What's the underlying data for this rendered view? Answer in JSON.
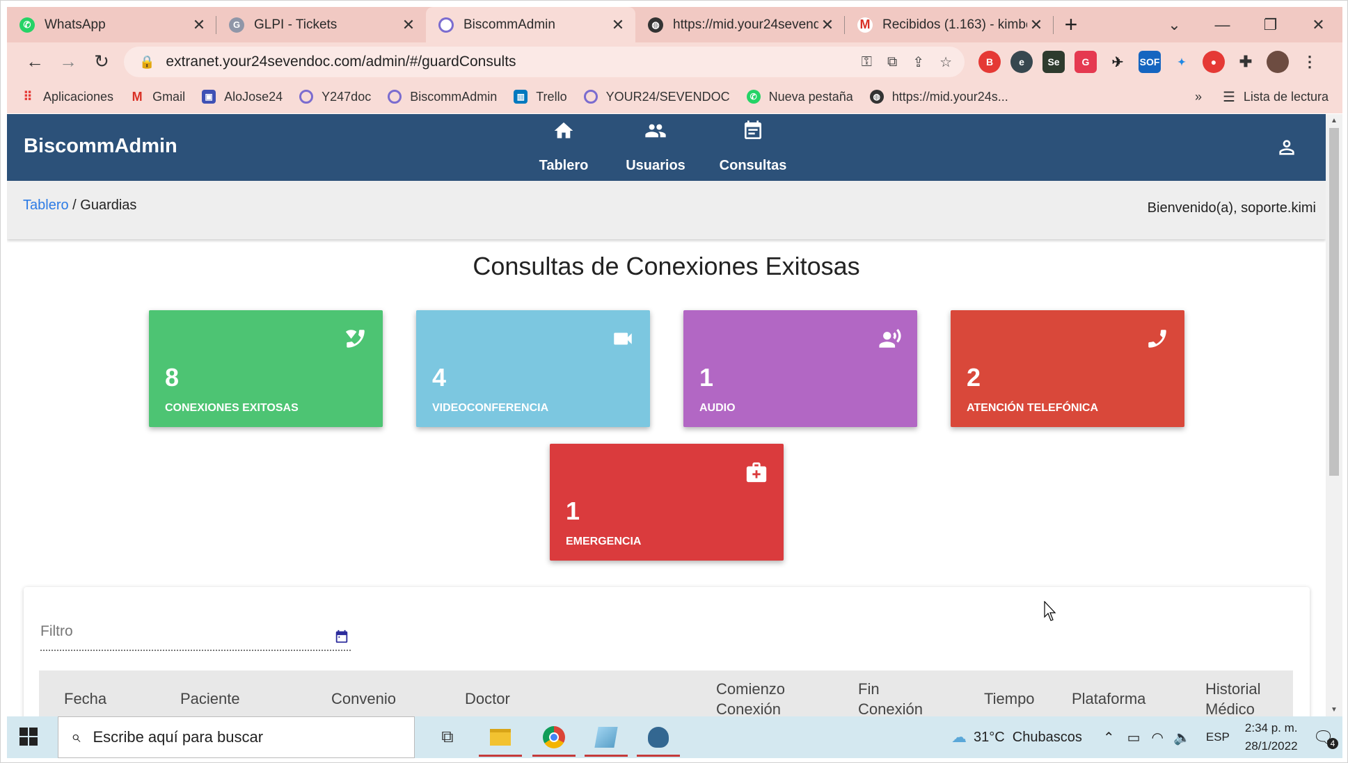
{
  "browser": {
    "tabs": [
      {
        "title": "WhatsApp",
        "favicon": "whatsapp-icon",
        "active": false
      },
      {
        "title": "GLPI - Tickets",
        "favicon": "glpi-icon",
        "active": false
      },
      {
        "title": "BiscommAdmin",
        "favicon": "biscomm-icon",
        "active": true
      },
      {
        "title": "https://mid.your24sevend",
        "favicon": "globe-icon",
        "active": false
      },
      {
        "title": "Recibidos (1.163) - kimbe",
        "favicon": "gmail-icon",
        "active": false
      }
    ],
    "new_tab": "+",
    "url": "extranet.your24sevendoc.com/admin/#/guardConsults",
    "bookmarks": [
      {
        "label": "Aplicaciones",
        "icon": "apps-grid-icon"
      },
      {
        "label": "Gmail",
        "icon": "gmail-icon"
      },
      {
        "label": "AloJose24",
        "icon": "bookmark-page-icon"
      },
      {
        "label": "Y247doc",
        "icon": "biscomm-icon"
      },
      {
        "label": "BiscommAdmin",
        "icon": "biscomm-icon"
      },
      {
        "label": "Trello",
        "icon": "trello-icon"
      },
      {
        "label": "YOUR24/SEVENDOC",
        "icon": "biscomm-icon"
      },
      {
        "label": "Nueva pestaña",
        "icon": "whatsapp-icon"
      },
      {
        "label": "https://mid.your24s...",
        "icon": "globe-icon"
      }
    ],
    "reading_list": "Lista de lectura",
    "overflow": "»"
  },
  "app": {
    "brand": "BiscommAdmin",
    "nav": [
      {
        "label": "Tablero",
        "icon": "home-icon"
      },
      {
        "label": "Usuarios",
        "icon": "users-icon"
      },
      {
        "label": "Consultas",
        "icon": "calendar-icon"
      }
    ],
    "breadcrumb": {
      "link": "Tablero",
      "separator": " / ",
      "current": "Guardias"
    },
    "welcome": "Bienvenido(a), soporte.kimi",
    "title": "Consultas de Conexiones Exitosas",
    "cards": [
      {
        "value": "8",
        "label": "CONEXIONES EXITOSAS",
        "color": "#4dc473",
        "icon": "wifi-calling-icon"
      },
      {
        "value": "4",
        "label": "VIDEOCONFERENCIA",
        "color": "#7cc7e0",
        "icon": "videocam-icon"
      },
      {
        "value": "1",
        "label": "AUDIO",
        "color": "#b267c4",
        "icon": "record-voice-icon"
      },
      {
        "value": "2",
        "label": "ATENCIÓN TELEFÓNICA",
        "color": "#d9483a",
        "icon": "phone-icon"
      },
      {
        "value": "1",
        "label": "EMERGENCIA",
        "color": "#da3b3d",
        "icon": "medical-kit-icon"
      }
    ],
    "filter": {
      "placeholder": "Filtro",
      "value": ""
    },
    "table_headers": [
      "Fecha",
      "Paciente",
      "Convenio",
      "Doctor",
      "Comienzo\nConexión",
      "Fin\nConexión",
      "Tiempo",
      "Plataforma",
      "Historial\nMédico"
    ]
  },
  "taskbar": {
    "search_placeholder": "Escribe aquí para buscar",
    "weather": "31°C  Chubascos",
    "language": "ESP",
    "time": "2:34 p. m.",
    "date": "28/1/2022",
    "notifications": "4"
  }
}
